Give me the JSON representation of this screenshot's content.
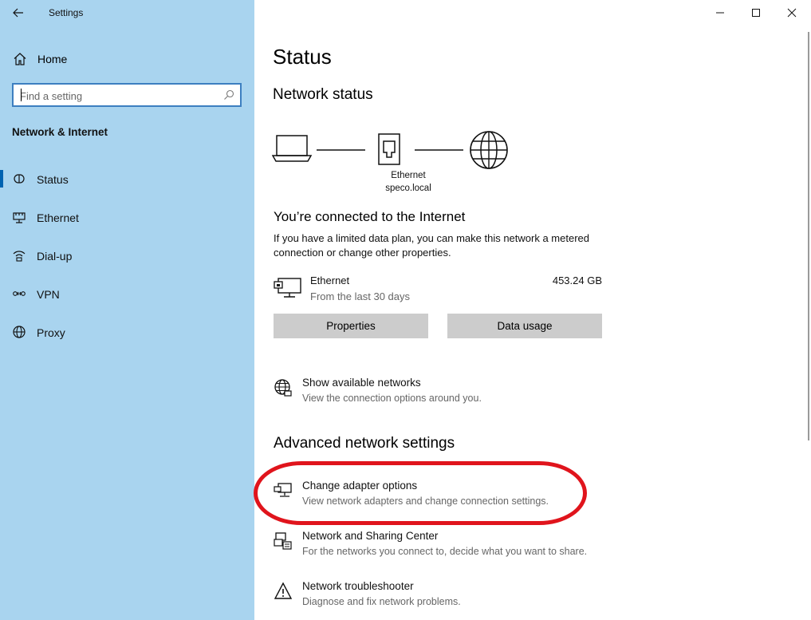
{
  "window": {
    "title": "Settings",
    "controls": {
      "minimize": "minimize-icon",
      "maximize": "maximize-icon",
      "close": "close-icon"
    }
  },
  "sidebar": {
    "home_label": "Home",
    "search_placeholder": "Find a setting",
    "section_title": "Network & Internet",
    "items": [
      {
        "label": "Status",
        "icon": "status-icon",
        "active": true
      },
      {
        "label": "Ethernet",
        "icon": "ethernet-icon",
        "active": false
      },
      {
        "label": "Dial-up",
        "icon": "dialup-icon",
        "active": false
      },
      {
        "label": "VPN",
        "icon": "vpn-icon",
        "active": false
      },
      {
        "label": "Proxy",
        "icon": "proxy-icon",
        "active": false
      }
    ]
  },
  "main": {
    "title": "Status",
    "network_status_heading": "Network status",
    "diagram": {
      "adapter_name": "Ethernet",
      "domain": "speco.local"
    },
    "connected_title": "You’re connected to the Internet",
    "connected_desc": "If you have a limited data plan, you can make this network a metered connection or change other properties.",
    "connection": {
      "name": "Ethernet",
      "subtitle": "From the last 30 days",
      "usage": "453.24 GB"
    },
    "buttons": {
      "properties": "Properties",
      "data_usage": "Data usage"
    },
    "show_networks": {
      "title": "Show available networks",
      "desc": "View the connection options around you."
    },
    "advanced_heading": "Advanced network settings",
    "advanced_items": [
      {
        "title": "Change adapter options",
        "desc": "View network adapters and change connection settings."
      },
      {
        "title": "Network and Sharing Center",
        "desc": "For the networks you connect to, decide what you want to share."
      },
      {
        "title": "Network troubleshooter",
        "desc": "Diagnose and fix network problems."
      }
    ]
  },
  "colors": {
    "sidebar_bg": "#a9d4ef",
    "accent": "#0063b1",
    "highlight": "#e0141c",
    "button_bg": "#cccccc"
  }
}
